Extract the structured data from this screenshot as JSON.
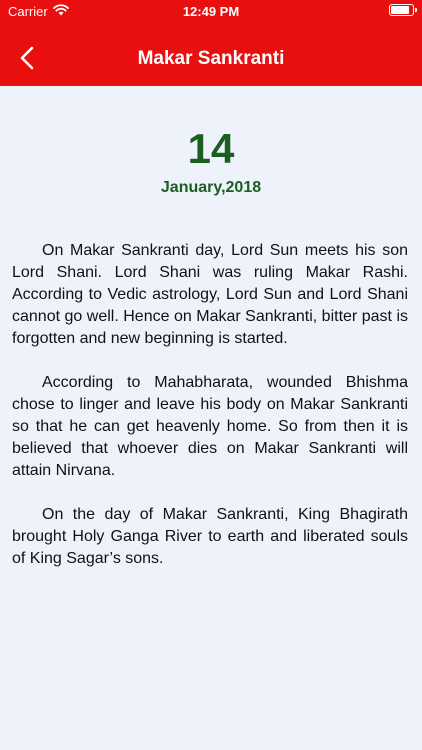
{
  "status": {
    "carrier": "Carrier",
    "time": "12:49 PM"
  },
  "nav": {
    "title": "Makar Sankranti"
  },
  "date": {
    "day": "14",
    "month_year": "January,2018"
  },
  "paragraphs": [
    "On Makar Sankranti day, Lord Sun meets his son Lord Shani. Lord Shani was ruling Makar Rashi. According to Vedic astrology, Lord Sun and Lord Shani cannot go well. Hence on Makar Sankranti, bitter past is forgotten and new beginning is started.",
    "According to Mahabharata, wounded Bhishma chose to linger and leave his body on Makar Sankranti so that he can get heavenly home. So from then it is believed that whoever dies on Makar Sankranti will attain Nirvana.",
    "On the day of Makar Sankranti, King Bhagirath brought Holy Ganga River to earth and liberated souls of King Sagar’s sons."
  ],
  "colors": {
    "header": "#ea0f0f",
    "date_text": "#1b5e20",
    "background": "#eef3fb"
  },
  "icons": {
    "back": "chevron-left-icon",
    "wifi": "wifi-icon",
    "battery": "battery-icon"
  }
}
